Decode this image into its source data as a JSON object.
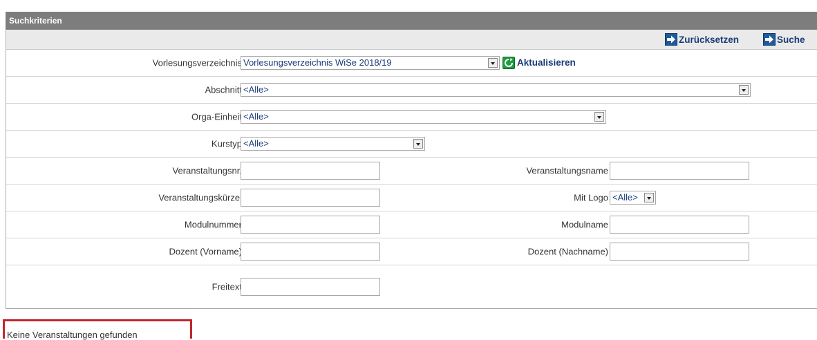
{
  "header": {
    "title": "Suchkriterien"
  },
  "toolbar": {
    "reset_label": "Zurücksetzen",
    "search_label": "Suche"
  },
  "form": {
    "vorlesungsverzeichnis": {
      "label": "Vorlesungsverzeichnis",
      "value": "Vorlesungsverzeichnis WiSe 2018/19",
      "refresh_label": "Aktualisieren"
    },
    "abschnitt": {
      "label": "Abschnitt",
      "value": "<Alle>"
    },
    "orga_einheit": {
      "label": "Orga-Einheit",
      "value": "<Alle>"
    },
    "kurstyp": {
      "label": "Kurstyp",
      "value": "<Alle>"
    },
    "veranstaltungsnr": {
      "label": "Veranstaltungsnr.",
      "value": ""
    },
    "veranstaltungsname": {
      "label": "Veranstaltungsname",
      "value": ""
    },
    "veranstaltungskuerzel": {
      "label": "Veranstaltungskürzel",
      "value": ""
    },
    "mit_logo": {
      "label": "Mit Logo",
      "value": "<Alle>"
    },
    "modulnummer": {
      "label": "Modulnummer",
      "value": ""
    },
    "modulname": {
      "label": "Modulname",
      "value": ""
    },
    "dozent_vorname": {
      "label": "Dozent (Vorname)",
      "value": ""
    },
    "dozent_nachname": {
      "label": "Dozent (Nachname)",
      "value": ""
    },
    "freitext": {
      "label": "Freitext",
      "value": ""
    }
  },
  "result": {
    "message": "Keine Veranstaltungen gefunden"
  },
  "colors": {
    "header_bg": "#7d7d7d",
    "toolbar_bg": "#eaeaea",
    "link": "#1a3c78",
    "icon_blue": "#1e5b9c",
    "icon_green": "#1f9e3e",
    "highlight": "#c0262e"
  },
  "icons": {
    "reset": "arrow-right-icon",
    "search": "arrow-right-icon",
    "refresh": "refresh-icon",
    "dropdown": "chevron-down-icon"
  }
}
